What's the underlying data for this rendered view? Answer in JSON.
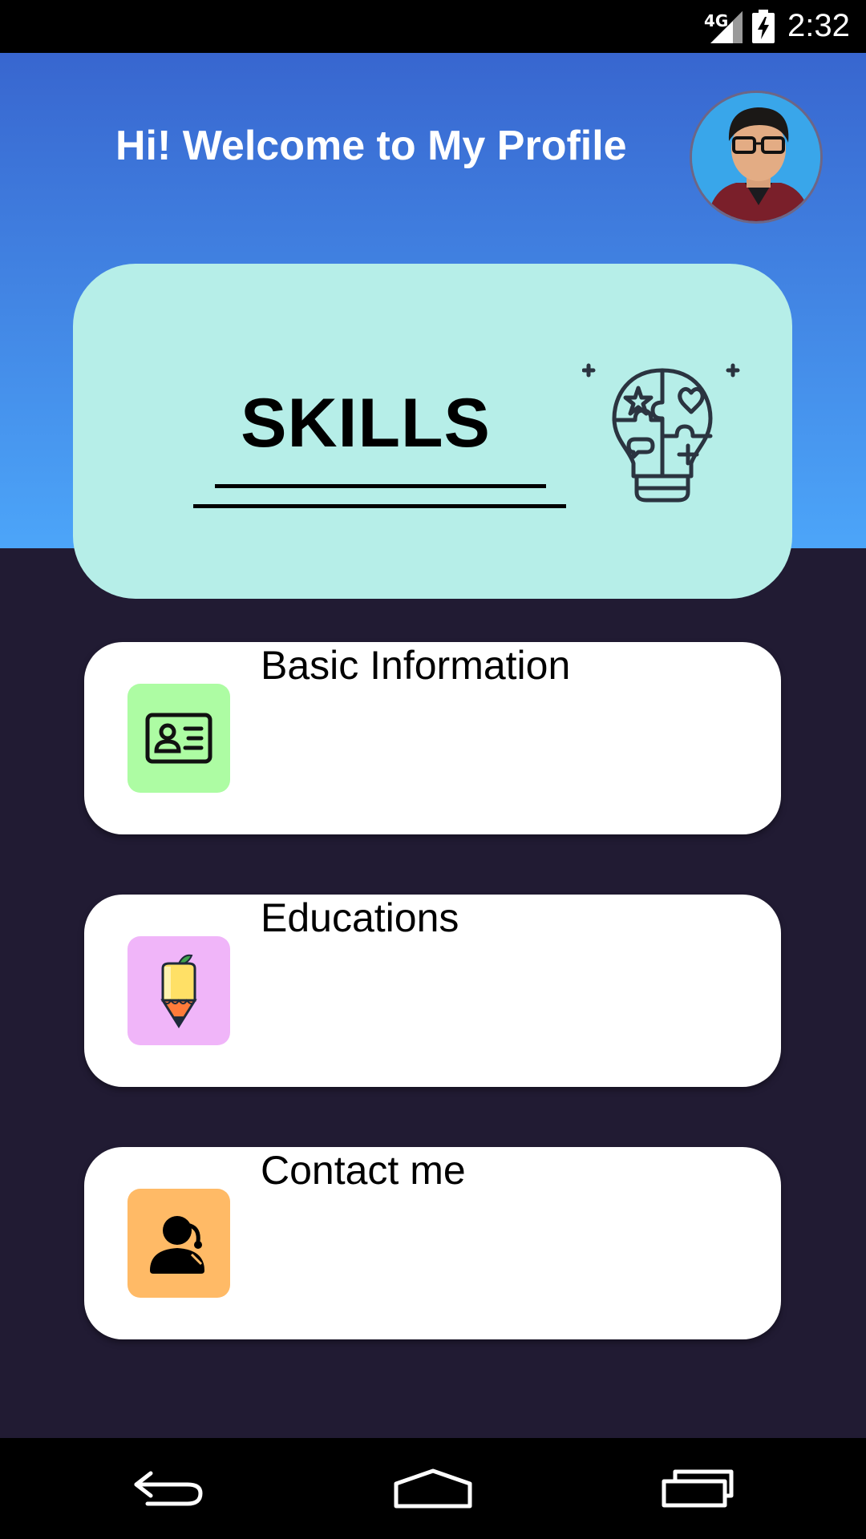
{
  "status_bar": {
    "network": "4G",
    "time": "2:32",
    "icons": [
      "signal-icon",
      "battery-charging-icon"
    ]
  },
  "header": {
    "title": "Hi! Welcome to My Profile",
    "avatar": "profile-photo"
  },
  "skills_card": {
    "title": "SKILLS",
    "icon": "lightbulb-puzzle-icon"
  },
  "menu": {
    "items": [
      {
        "label": "Basic Information",
        "icon": "id-card-icon",
        "icon_bg": "#adfca3"
      },
      {
        "label": "Educations",
        "icon": "pencil-icon",
        "icon_bg": "#f0b5f9"
      },
      {
        "label": "Contact me",
        "icon": "person-icon",
        "icon_bg": "#ffba66"
      }
    ]
  },
  "nav_bar": {
    "buttons": [
      "back-icon",
      "home-icon",
      "recents-icon"
    ]
  },
  "colors": {
    "header_top": "#3866cf",
    "header_bottom": "#4ca5f9",
    "background": "#211b33",
    "skills_card": "#b6eee8"
  }
}
